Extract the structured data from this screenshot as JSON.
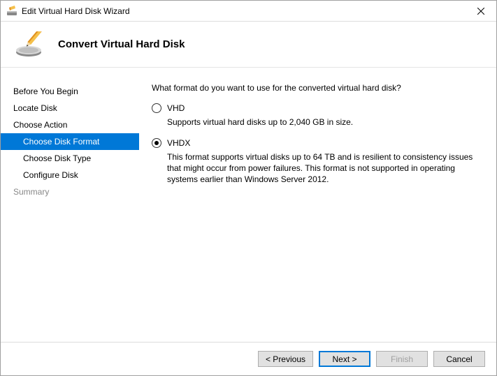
{
  "window": {
    "title": "Edit Virtual Hard Disk Wizard"
  },
  "header": {
    "title": "Convert Virtual Hard Disk"
  },
  "nav": {
    "items": [
      {
        "label": "Before You Begin",
        "sub": false,
        "selected": false,
        "dim": false
      },
      {
        "label": "Locate Disk",
        "sub": false,
        "selected": false,
        "dim": false
      },
      {
        "label": "Choose Action",
        "sub": false,
        "selected": false,
        "dim": false
      },
      {
        "label": "Choose Disk Format",
        "sub": true,
        "selected": true,
        "dim": false
      },
      {
        "label": "Choose Disk Type",
        "sub": true,
        "selected": false,
        "dim": false
      },
      {
        "label": "Configure Disk",
        "sub": true,
        "selected": false,
        "dim": false
      },
      {
        "label": "Summary",
        "sub": false,
        "selected": false,
        "dim": true
      }
    ]
  },
  "content": {
    "question": "What format do you want to use for the converted virtual hard disk?",
    "options": [
      {
        "label": "VHD",
        "desc": "Supports virtual hard disks up to 2,040 GB in size.",
        "selected": false
      },
      {
        "label": "VHDX",
        "desc": "This format supports virtual disks up to 64 TB and is resilient to consistency issues that might occur from power failures. This format is not supported in operating systems earlier than Windows Server 2012.",
        "selected": true
      }
    ]
  },
  "buttons": {
    "previous": "< Previous",
    "next": "Next >",
    "finish": "Finish",
    "cancel": "Cancel"
  }
}
